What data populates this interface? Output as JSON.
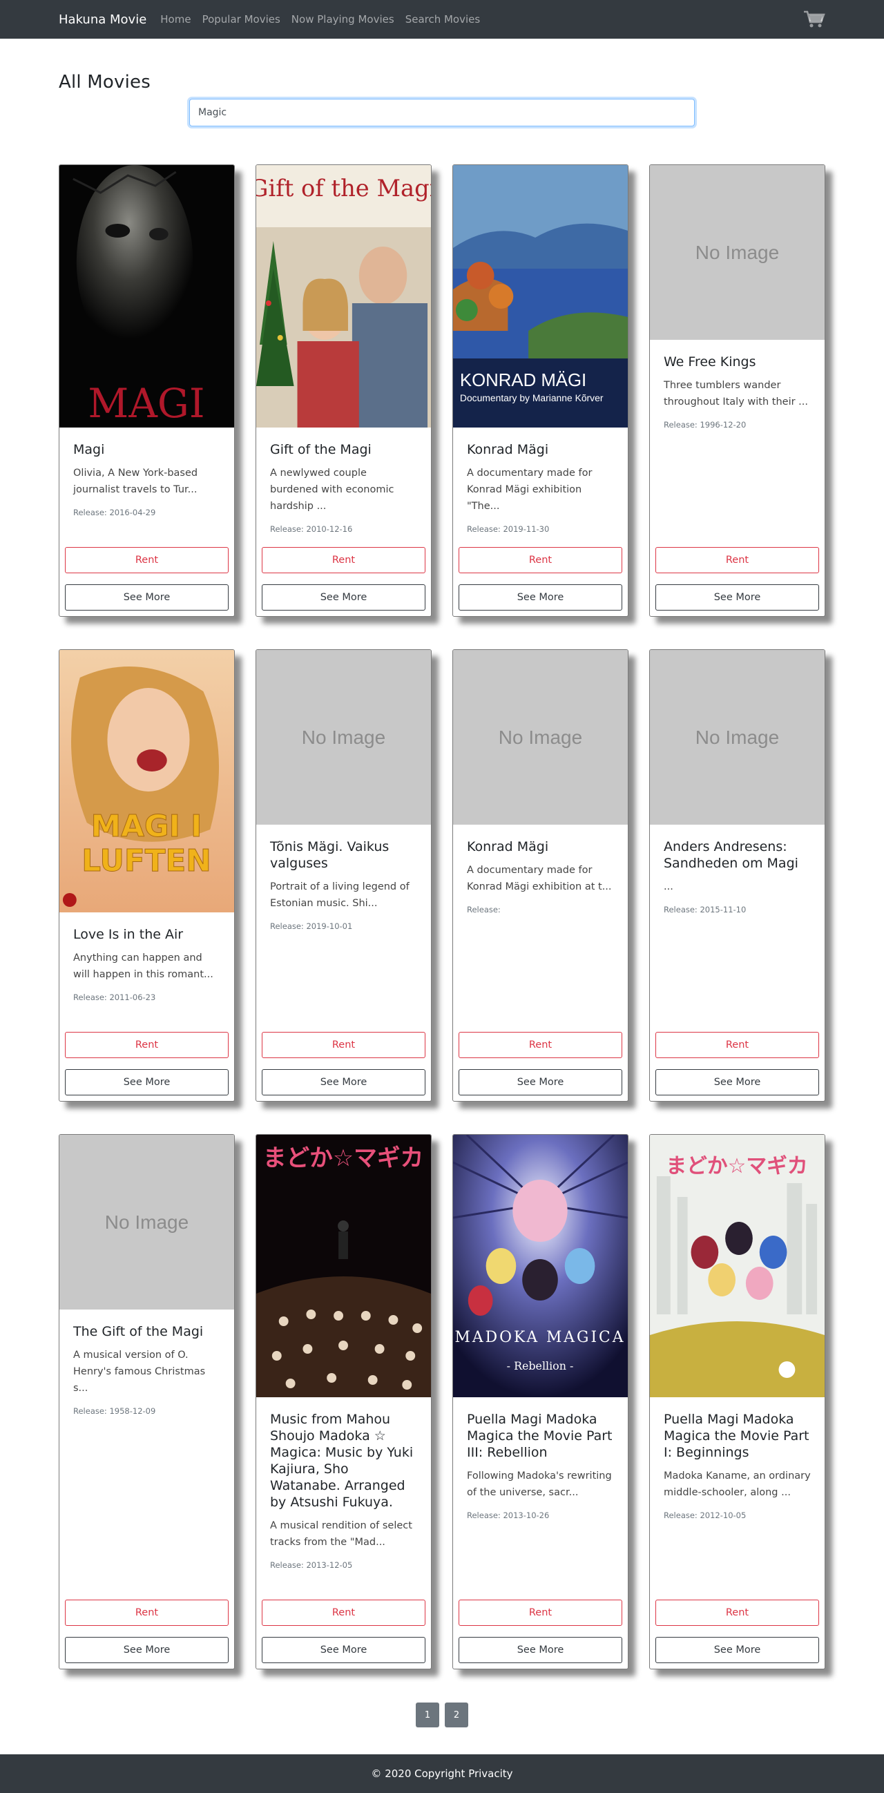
{
  "navbar": {
    "brand": "Hakuna Movie",
    "links": [
      "Home",
      "Popular Movies",
      "Now Playing Movies",
      "Search Movies"
    ]
  },
  "page": {
    "title": "All Movies"
  },
  "search": {
    "value": "Magic"
  },
  "buttons": {
    "rent": "Rent",
    "see_more": "See More"
  },
  "no_image_text": "No Image",
  "movies": [
    {
      "title": "Magi",
      "overview": "Olivia, A New York-based journalist travels to Tur...",
      "release": "Release: 2016-04-29",
      "poster_text": "MAGI"
    },
    {
      "title": "Gift of the Magi",
      "overview": "A newlywed couple burdened with economic hardship ...",
      "release": "Release: 2010-12-16",
      "poster_text": "Gift of the Magi"
    },
    {
      "title": "Konrad Mägi",
      "overview": "A documentary made for Konrad Mägi exhibition \"The...",
      "release": "Release: 2019-11-30",
      "poster_text": "KONRAD MÄGI",
      "poster_subtext": "Documentary by Marianne Kõrver"
    },
    {
      "title": "We Free Kings",
      "overview": "Three tumblers wander throughout Italy with their ...",
      "release": "Release: 1996-12-20"
    },
    {
      "title": "Love Is in the Air",
      "overview": "Anything can happen and will happen in this romant...",
      "release": "Release: 2011-06-23",
      "poster_text": "MAGI I LUFTEN"
    },
    {
      "title": "Tõnis Mägi. Vaikus valguses",
      "overview": "Portrait of a living legend of Estonian music. Shi...",
      "release": "Release: 2019-10-01"
    },
    {
      "title": "Konrad Mägi",
      "overview": "A documentary made for Konrad Mägi exhibition at t...",
      "release": "Release:"
    },
    {
      "title": "Anders Andresens: Sandheden om Magi",
      "overview": "...",
      "release": "Release: 2015-11-10"
    },
    {
      "title": "The Gift of the Magi",
      "overview": "A musical version of O. Henry's famous Christmas s...",
      "release": "Release: 1958-12-09"
    },
    {
      "title": "Music from Mahou Shoujo Madoka ☆ Magica: Music by Yuki Kajiura, Sho Watanabe. Arranged by Atsushi Fukuya.",
      "overview": "A musical rendition of select tracks from the \"Mad...",
      "release": "Release: 2013-12-05",
      "poster_text": "まどか☆マギカ"
    },
    {
      "title": "Puella Magi Madoka Magica the Movie Part III: Rebellion",
      "overview": "Following Madoka's rewriting of the universe, sacr...",
      "release": "Release: 2013-10-26",
      "poster_text": "MADOKA MAGICA",
      "poster_subtext": "- Rebellion -"
    },
    {
      "title": "Puella Magi Madoka Magica the Movie Part I: Beginnings",
      "overview": "Madoka Kaname, an ordinary middle-schooler, along ...",
      "release": "Release: 2012-10-05",
      "poster_text": "まどか☆マギカ"
    }
  ],
  "pagination": [
    "1",
    "2"
  ],
  "footer": {
    "text": "© 2020 Copyright Privacity"
  }
}
